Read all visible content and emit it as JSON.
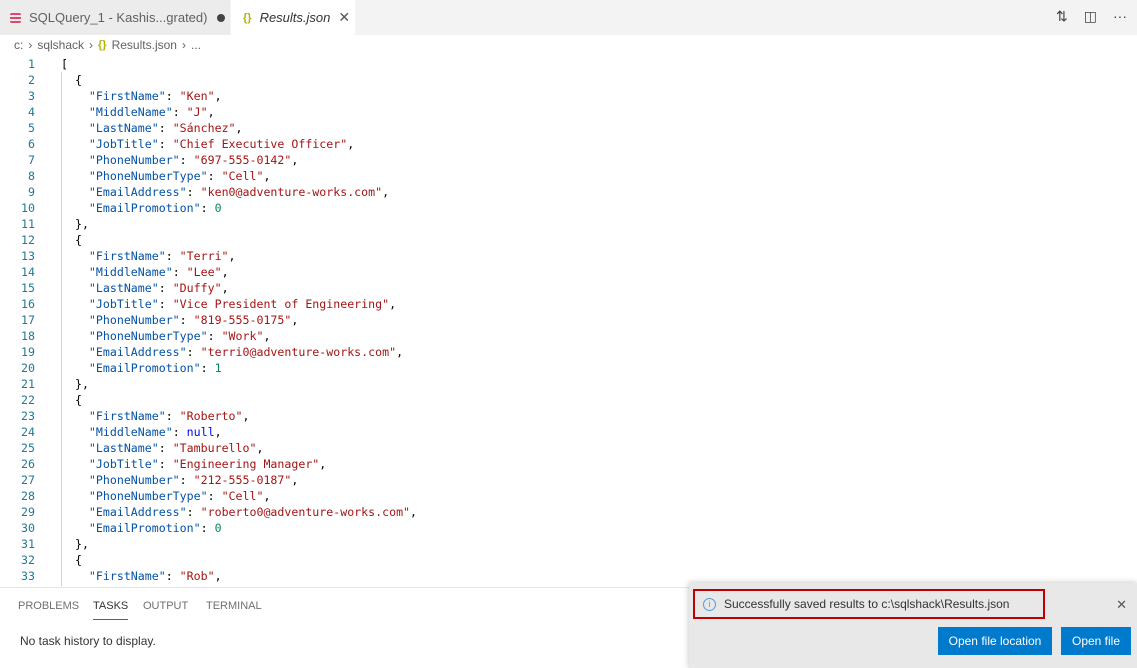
{
  "tabs": [
    {
      "label": "SQLQuery_1 - Kashis...grated)",
      "icon": "database-icon",
      "dirty": true
    },
    {
      "label": "Results.json",
      "icon": "json-icon",
      "active": true
    }
  ],
  "breadcrumb": [
    "c:",
    "sqlshack",
    "Results.json",
    "..."
  ],
  "code_lines": [
    "[",
    "  {",
    "    \"FirstName\": \"Ken\",",
    "    \"MiddleName\": \"J\",",
    "    \"LastName\": \"Sánchez\",",
    "    \"JobTitle\": \"Chief Executive Officer\",",
    "    \"PhoneNumber\": \"697-555-0142\",",
    "    \"PhoneNumberType\": \"Cell\",",
    "    \"EmailAddress\": \"ken0@adventure-works.com\",",
    "    \"EmailPromotion\": 0",
    "  },",
    "  {",
    "    \"FirstName\": \"Terri\",",
    "    \"MiddleName\": \"Lee\",",
    "    \"LastName\": \"Duffy\",",
    "    \"JobTitle\": \"Vice President of Engineering\",",
    "    \"PhoneNumber\": \"819-555-0175\",",
    "    \"PhoneNumberType\": \"Work\",",
    "    \"EmailAddress\": \"terri0@adventure-works.com\",",
    "    \"EmailPromotion\": 1",
    "  },",
    "  {",
    "    \"FirstName\": \"Roberto\",",
    "    \"MiddleName\": null,",
    "    \"LastName\": \"Tamburello\",",
    "    \"JobTitle\": \"Engineering Manager\",",
    "    \"PhoneNumber\": \"212-555-0187\",",
    "    \"PhoneNumberType\": \"Cell\",",
    "    \"EmailAddress\": \"roberto0@adventure-works.com\",",
    "    \"EmailPromotion\": 0",
    "  },",
    "  {",
    "    \"FirstName\": \"Rob\","
  ],
  "panel": {
    "tabs": [
      "PROBLEMS",
      "TASKS",
      "OUTPUT",
      "TERMINAL"
    ],
    "active": "TASKS",
    "message": "No task history to display."
  },
  "toast": {
    "message": "Successfully saved results to c:\\sqlshack\\Results.json",
    "buttons": [
      "Open file location",
      "Open file"
    ]
  }
}
